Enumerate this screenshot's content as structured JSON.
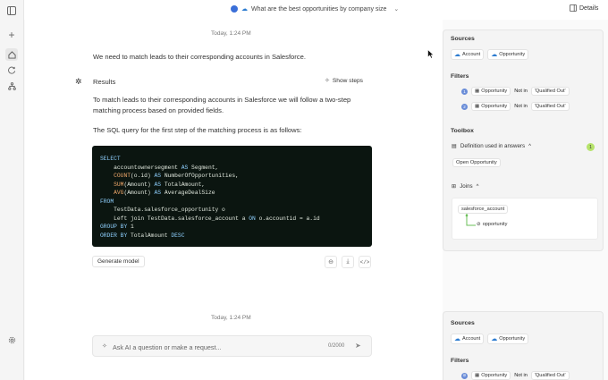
{
  "topbar": {
    "title": "What are the best opportunities by company size",
    "details_label": "Details"
  },
  "conversation": {
    "timestamp1": "Today, 1:24 PM",
    "user_message": "We need to match leads to their corresponding accounts in Salesforce.",
    "results_label": "Results",
    "show_steps_label": "Show steps",
    "para1_line1": "To match leads to their corresponding accounts in Salesforce we will follow a two-step",
    "para1_line2": "matching process based on provided fields.",
    "para2": "The SQL query for the first step of the matching process is as follows:",
    "generate_model_label": "Generate model",
    "timestamp2": "Today, 1:24 PM"
  },
  "input": {
    "placeholder": "Ask AI a question or make a request...",
    "counter": "0/2000"
  },
  "panel": {
    "sources_label": "Sources",
    "sources": [
      "Account",
      "Opportunity"
    ],
    "filters_label": "Filters",
    "filters": [
      {
        "num": "1",
        "table": "Opportunity",
        "op": "Not in",
        "value": "'Qualified Out'"
      },
      {
        "num": "2",
        "table": "Opportunity",
        "op": "Not in",
        "value": "'Qualified Out'"
      }
    ],
    "toolbox_label": "Toolbox",
    "definition_label": "Definition used in answers",
    "definition_count": "1",
    "definition_item": "Open Opportunity",
    "joins_label": "Joins",
    "join_from": "salesforce_account",
    "join_to": "opportunity"
  },
  "panel2": {
    "sources_label": "Sources",
    "sources": [
      "Account",
      "Opportunity"
    ],
    "filters_label": "Filters",
    "filter": {
      "table": "Opportunity",
      "op": "Not in",
      "value": "'Qualified Out'"
    }
  },
  "colors": {
    "accent_green": "#b6e36b",
    "code_bg": "#0b1510",
    "salesforce_blue": "#2b7bd0"
  }
}
